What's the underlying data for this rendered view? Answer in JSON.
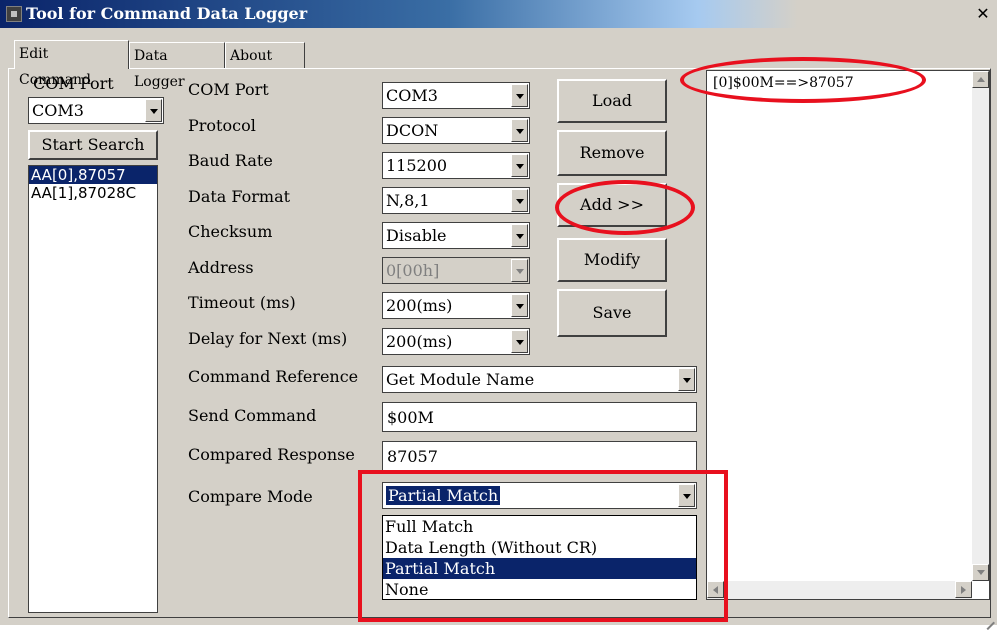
{
  "window": {
    "title": "Tool for Command Data Logger"
  },
  "tabs": [
    {
      "label": "Edit Command",
      "active": true
    },
    {
      "label": "Data Logger",
      "active": false
    },
    {
      "label": "About",
      "active": false
    }
  ],
  "left_panel": {
    "com_port_label": "COM Port",
    "com_port_value": "COM3",
    "start_search_label": "Start Search",
    "devices": [
      "AA[0],87057",
      "AA[1],87028C"
    ],
    "selected_device_index": 0
  },
  "form": {
    "com_port": {
      "label": "COM Port",
      "value": "COM3"
    },
    "protocol": {
      "label": "Protocol",
      "value": "DCON"
    },
    "baud_rate": {
      "label": "Baud Rate",
      "value": "115200"
    },
    "data_format": {
      "label": "Data Format",
      "value": "N,8,1"
    },
    "checksum": {
      "label": "Checksum",
      "value": "Disable"
    },
    "address": {
      "label": "Address",
      "value": "0[00h]",
      "enabled": false
    },
    "timeout": {
      "label": "Timeout (ms)",
      "value": "200(ms)"
    },
    "delay_next": {
      "label": "Delay for Next (ms)",
      "value": "200(ms)"
    },
    "command_reference": {
      "label": "Command Reference",
      "value": "Get Module Name"
    },
    "send_command": {
      "label": "Send Command",
      "value": "$00M"
    },
    "compared_response": {
      "label": "Compared Response",
      "value": "87057"
    },
    "compare_mode": {
      "label": "Compare Mode",
      "value": "Partial Match",
      "options": [
        "Full Match",
        "Data Length (Without CR)",
        "Partial Match",
        "None"
      ],
      "selected_index": 2
    }
  },
  "buttons": {
    "load": "Load",
    "remove": "Remove",
    "add": "Add >>",
    "modify": "Modify",
    "save": "Save"
  },
  "log": {
    "lines": [
      "[0]$00M==>87057"
    ]
  },
  "annotation_color": "#e8101e",
  "selection_color": "#0a246a"
}
